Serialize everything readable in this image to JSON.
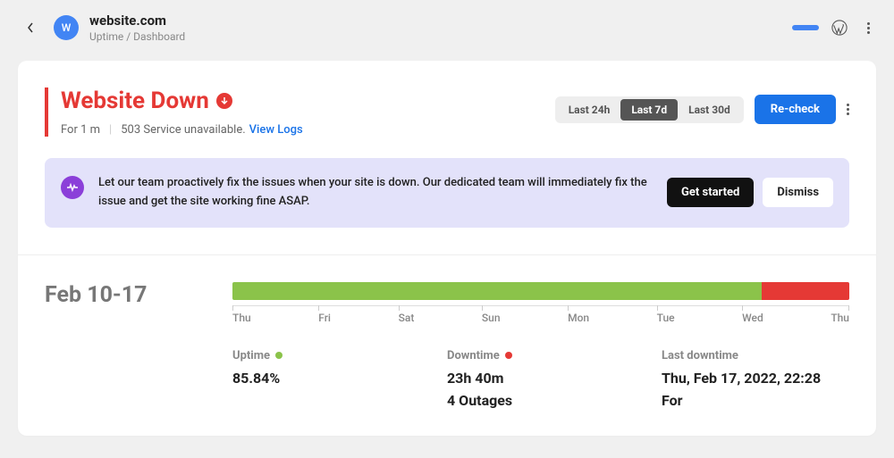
{
  "header": {
    "avatar_letter": "W",
    "site_name": "website.com",
    "breadcrumb": "Uptime / Dashboard"
  },
  "status": {
    "title": "Website Down",
    "duration": "For 1 m",
    "error": "503 Service unavailable.",
    "view_logs": "View Logs"
  },
  "range": {
    "options": [
      "Last 24h",
      "Last 7d",
      "Last 30d"
    ],
    "active": "Last 7d"
  },
  "actions": {
    "recheck": "Re-check"
  },
  "banner": {
    "text": "Let our team proactively fix the issues when your site is down. Our dedicated team will immediately fix the issue and get the site working fine ASAP.",
    "primary": "Get started",
    "secondary": "Dismiss"
  },
  "timeline": {
    "label": "Feb 10-17",
    "days": [
      "Thu",
      "Fri",
      "Sat",
      "Sun",
      "Mon",
      "Tue",
      "Wed",
      "Thu"
    ],
    "segments": [
      {
        "color": "green",
        "pct": 85.84
      },
      {
        "color": "red",
        "pct": 14.16
      }
    ]
  },
  "stats": {
    "uptime": {
      "label": "Uptime",
      "value": "85.84%"
    },
    "downtime": {
      "label": "Downtime",
      "value": "23h 40m",
      "sub": "4 Outages"
    },
    "last": {
      "label": "Last downtime",
      "value": "Thu, Feb 17, 2022, 22:28",
      "sub": "For"
    }
  }
}
